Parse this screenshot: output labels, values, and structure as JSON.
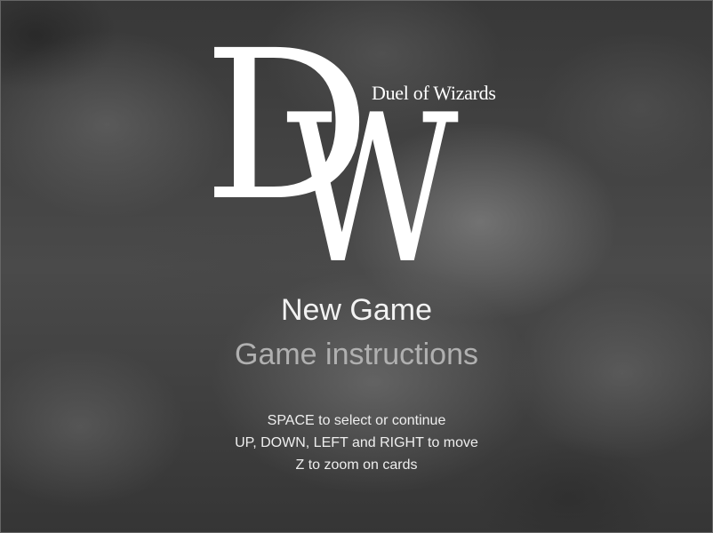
{
  "logo": {
    "letter_d": "D",
    "letter_w": "W",
    "title": "Duel of Wizards"
  },
  "menu": {
    "items": [
      {
        "label": "New Game",
        "selected": true
      },
      {
        "label": "Game instructions",
        "selected": false
      }
    ]
  },
  "controls_help": [
    "SPACE to select or continue",
    "UP, DOWN, LEFT and RIGHT to move",
    "Z to zoom on cards"
  ],
  "colors": {
    "logo": "#ffffff",
    "menu_selected": "#f2f2f2",
    "menu_unselected": "#b0b0b0",
    "help_text": "#eeeeee"
  }
}
